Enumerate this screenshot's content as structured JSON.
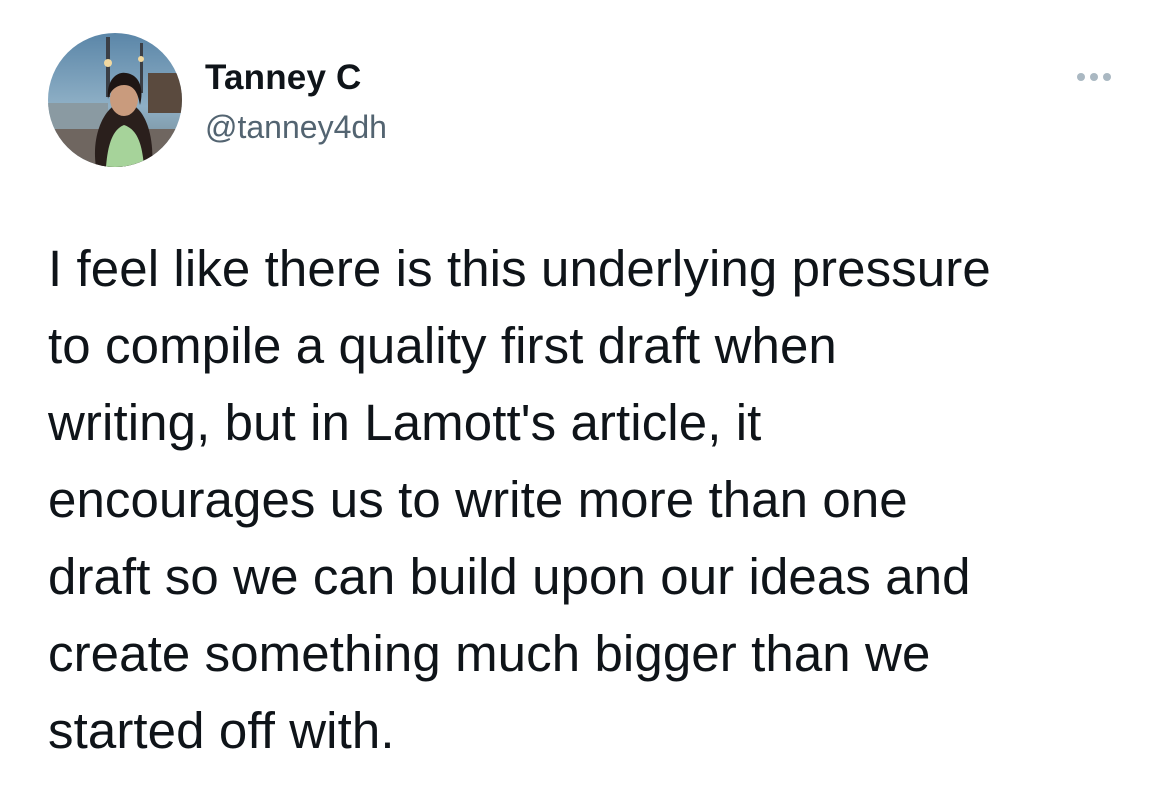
{
  "tweet": {
    "author": {
      "display_name": "Tanney C",
      "handle": "@tanney4dh",
      "avatar_icon": "profile-photo"
    },
    "more_icon": "more-options-icon",
    "text_lines": [
      "I feel like there is this underlying pressure",
      "to compile a quality first draft when",
      "writing, but in Lamott's article, it",
      "encourages us to write more than one",
      "draft so we can build upon our ideas and",
      "create something much bigger than we",
      "started off with."
    ]
  },
  "colors": {
    "text_primary": "#0f1419",
    "text_secondary": "#536471",
    "more_dots": "#aab8c2"
  }
}
